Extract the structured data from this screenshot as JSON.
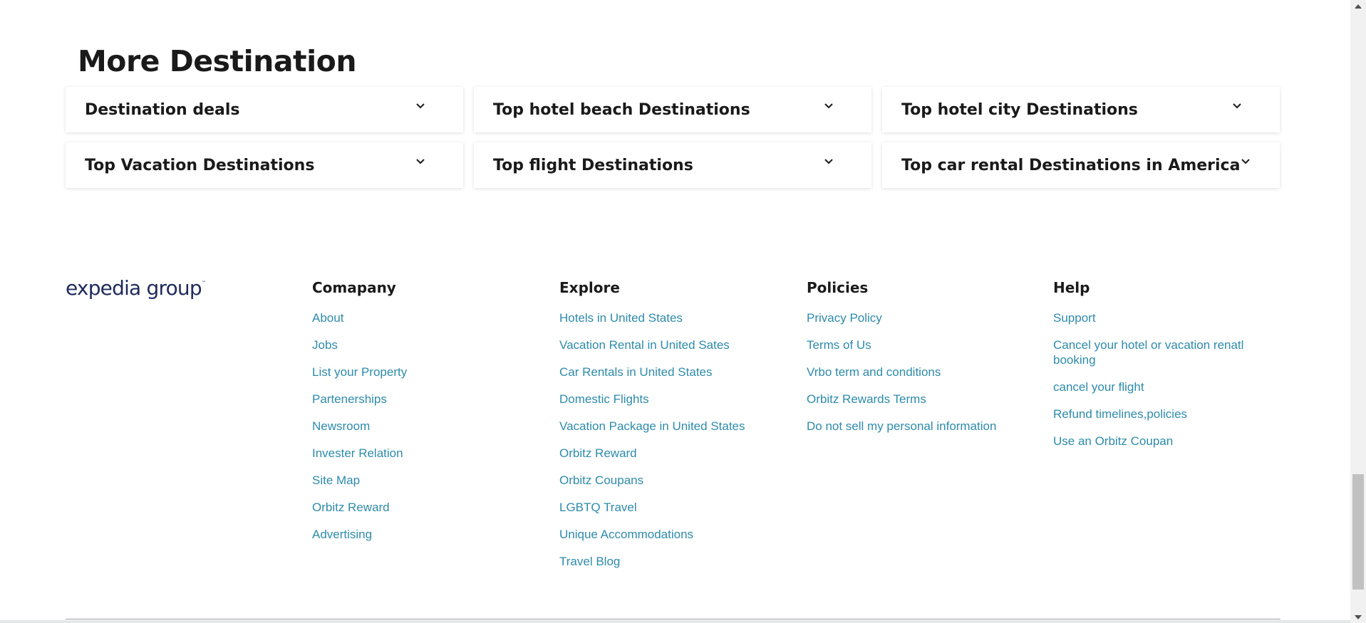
{
  "destinations": {
    "title": "More Destination",
    "items": [
      {
        "label": "Destination deals"
      },
      {
        "label": "Top hotel beach Destinations"
      },
      {
        "label": "Top hotel city Destinations"
      },
      {
        "label": "Top Vacation Destinations"
      },
      {
        "label": "Top flight Destinations"
      },
      {
        "label": "Top car rental Destinations in America"
      }
    ]
  },
  "footer": {
    "logo": {
      "text": "expedia group",
      "mark": "™"
    },
    "company": {
      "heading": "Comapany",
      "links": [
        "About",
        "Jobs",
        "List your Property",
        "Partenerships",
        "Newsroom",
        "Invester Relation",
        "Site Map",
        "Orbitz Reward",
        "Advertising"
      ]
    },
    "explore": {
      "heading": "Explore",
      "links": [
        "Hotels in United States",
        "Vacation Rental in United Sates",
        "Car Rentals in United States",
        "Domestic Flights",
        "Vacation Package in United States",
        "Orbitz Reward",
        "Orbitz Coupans",
        "LGBTQ Travel",
        "Unique Accommodations",
        "Travel Blog"
      ]
    },
    "policies": {
      "heading": "Policies",
      "links": [
        "Privacy Policy",
        "Terms of Us",
        "Vrbo term and conditions",
        "Orbitz Rewards Terms",
        "Do not sell my personal information"
      ]
    },
    "help": {
      "heading": "Help",
      "links": [
        "Support",
        "Cancel your hotel or vacation renatl booking",
        "cancel your flight",
        "Refund timelines,policies",
        "Use an Orbitz Coupan"
      ]
    }
  },
  "colors": {
    "link": "#2e8bab",
    "heading": "#1a1a1a",
    "logo": "#202a5c"
  },
  "icons": {
    "accordion": "chevron-down-icon",
    "scroll_up": "scroll-up-arrow-icon",
    "scroll_down": "scroll-down-arrow-icon"
  }
}
